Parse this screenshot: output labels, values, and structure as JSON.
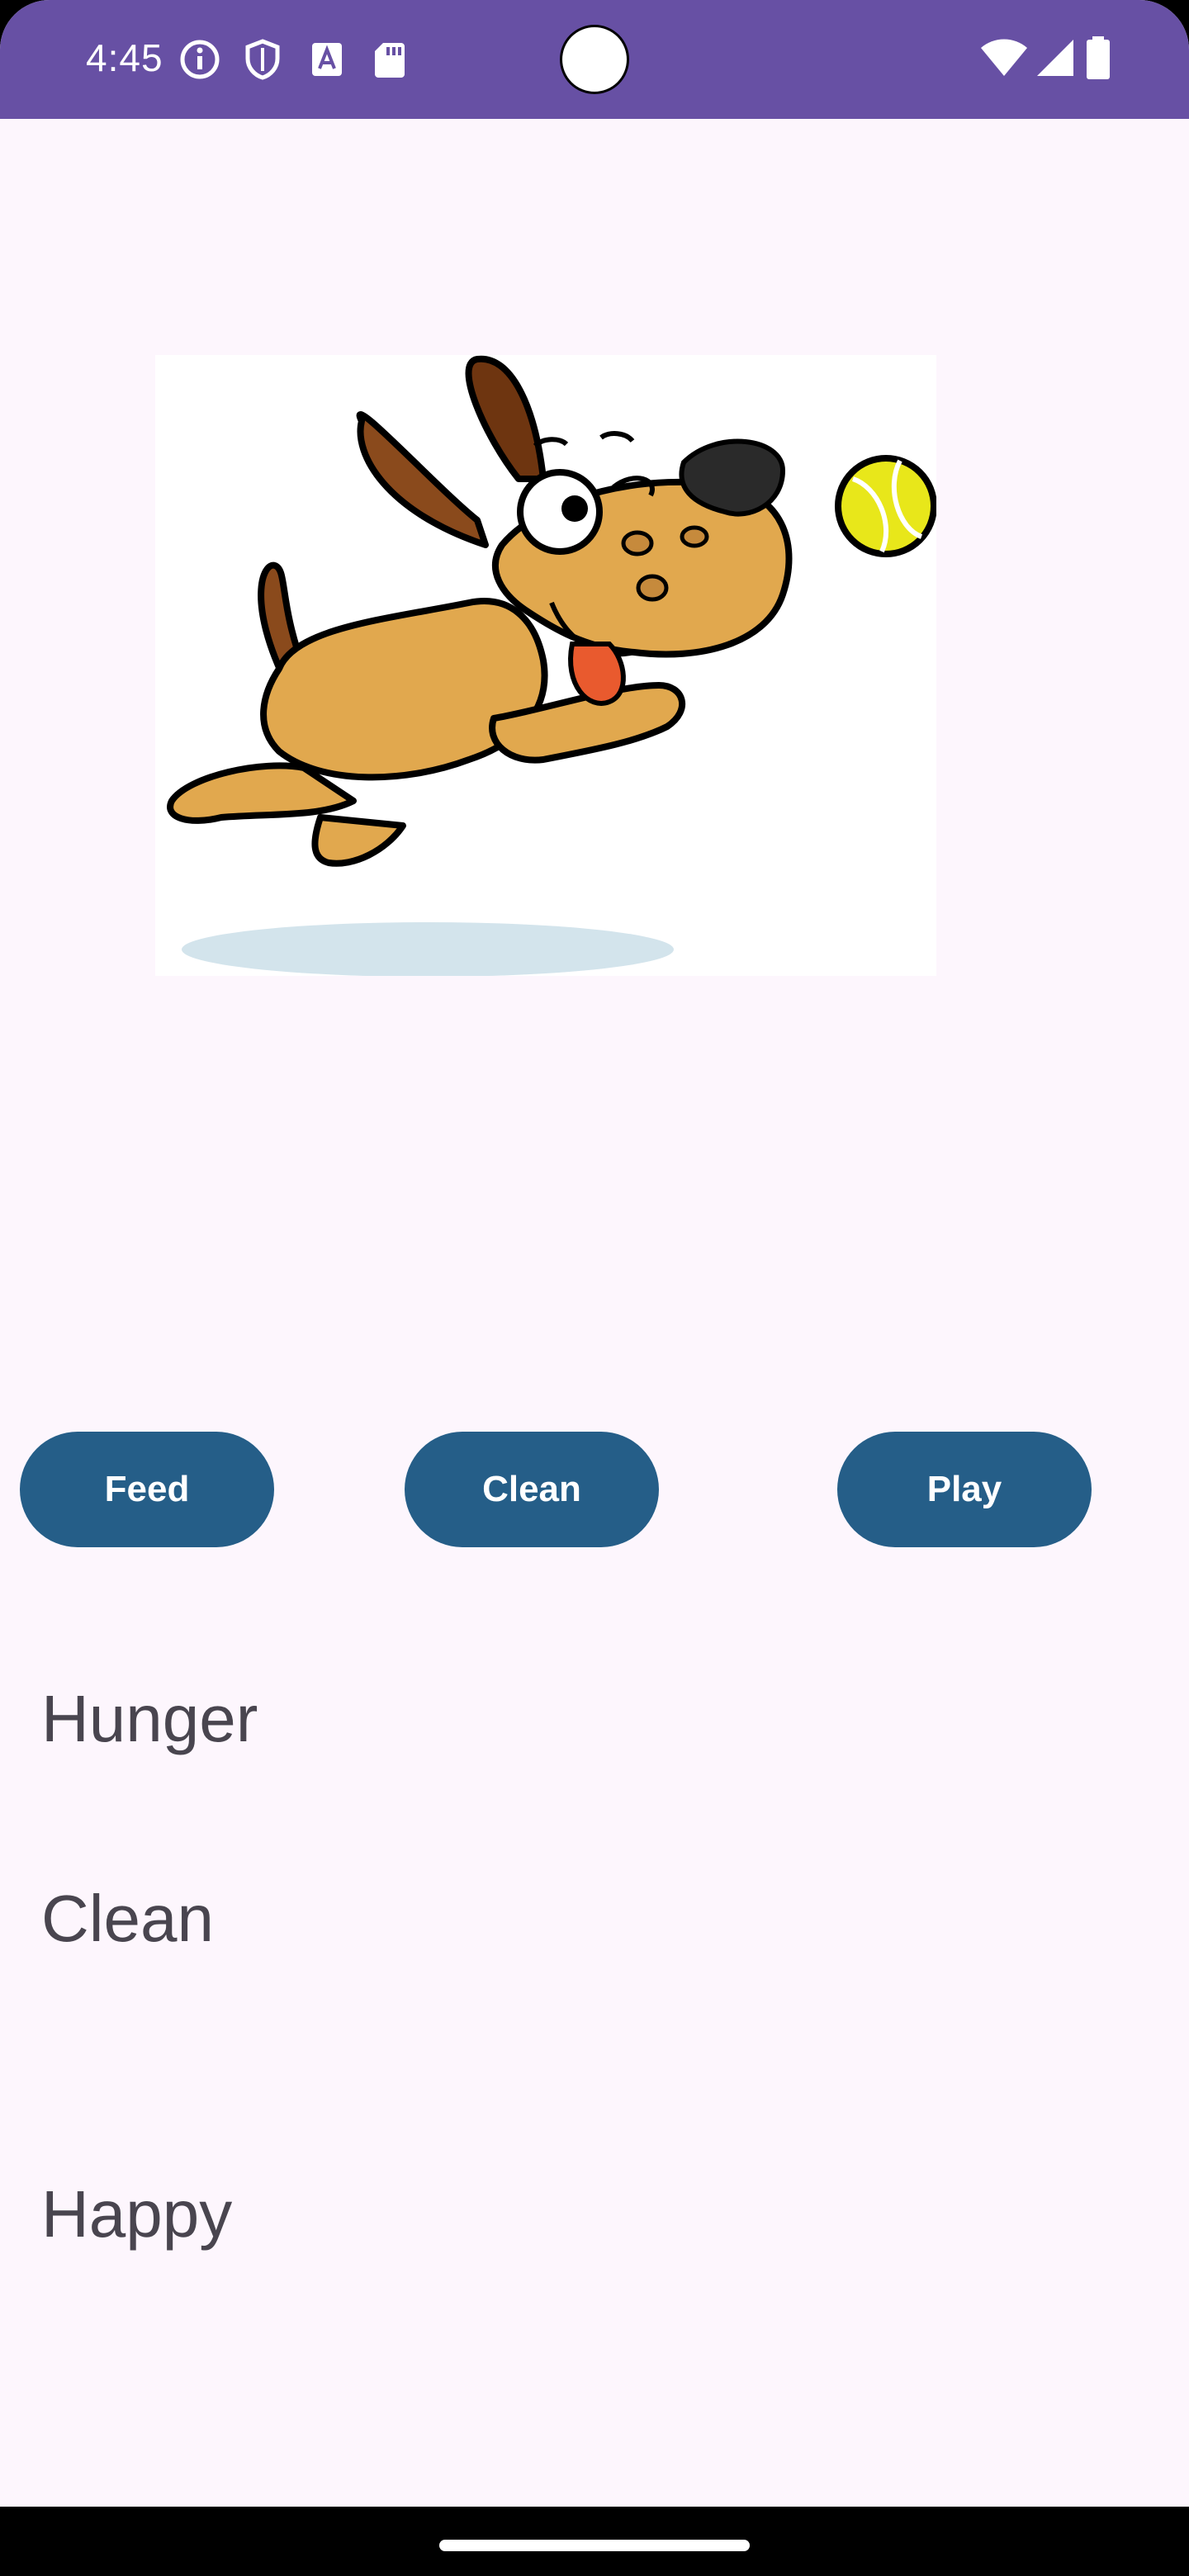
{
  "status_bar": {
    "time": "4:45",
    "left_icons": [
      "info-icon",
      "shield-icon",
      "font-a-icon",
      "sd-card-icon"
    ],
    "right_icons": [
      "wifi-icon",
      "signal-icon",
      "battery-icon"
    ],
    "background": "#6750A4"
  },
  "pet": {
    "image_icon": "dog-catching-ball-illustration"
  },
  "actions": {
    "feed_label": "Feed",
    "clean_label": "Clean",
    "play_label": "Play",
    "button_color": "#255E88"
  },
  "stats": {
    "hunger_label": "Hunger",
    "clean_label": "Clean",
    "happy_label": "Happy"
  },
  "theme": {
    "background": "#FDF6FD",
    "text_color": "#49454F"
  }
}
